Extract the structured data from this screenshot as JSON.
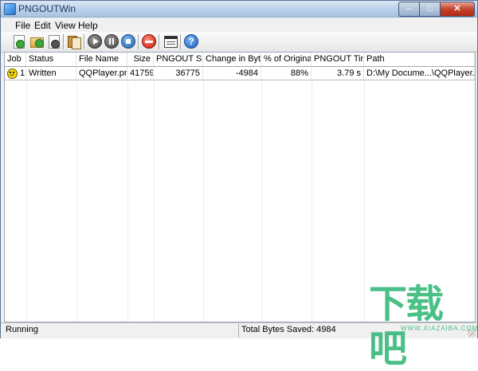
{
  "window": {
    "title": "PNGOUTWin",
    "controls": {
      "minimize": "–",
      "maximize": "□",
      "close": "✕"
    }
  },
  "menu": [
    {
      "label": "File"
    },
    {
      "label": "Edit"
    },
    {
      "label": "View"
    },
    {
      "label": "Help"
    }
  ],
  "toolbar": {
    "icons": [
      "add-file-icon",
      "add-folder-icon",
      "file-info-icon",
      "copy-icon",
      "start-icon",
      "pause-icon",
      "stop-icon",
      "remove-icon",
      "options-icon",
      "help-icon"
    ],
    "help_glyph": "?"
  },
  "table": {
    "columns": [
      "Job",
      "Status",
      "File Name",
      "Size",
      "PNGOUT Size",
      "Change in Bytes",
      "% of Original",
      "PNGOUT Time",
      "Path"
    ],
    "rows": [
      {
        "job": "1",
        "status": "Written",
        "file_name": "QQPlayer.png",
        "size": "41759",
        "pngout_size": "36775",
        "change": "-4984",
        "percent": "88%",
        "time": "3.79 s",
        "path": "D:\\My Docume...\\QQPlayer.png"
      }
    ]
  },
  "status": {
    "left": "Running",
    "right": "Total Bytes Saved: 4984"
  },
  "watermark": {
    "text": "下载吧",
    "url": "WWW.XIAZAIBA.COM",
    "color": "#2bb673"
  }
}
